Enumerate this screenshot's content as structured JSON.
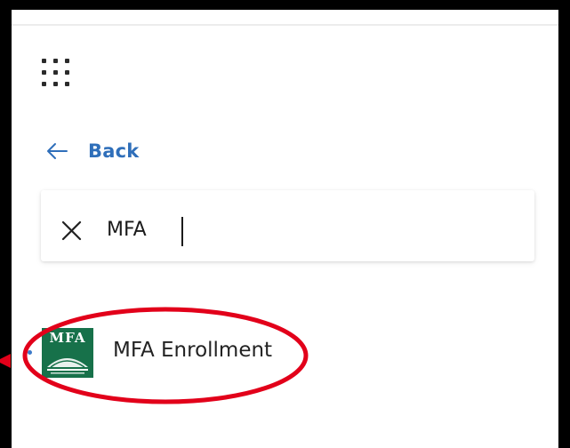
{
  "nav": {
    "back_label": "Back"
  },
  "search": {
    "value": "MFA"
  },
  "results": [
    {
      "name": "MFA Enrollment",
      "logo_text": "MFA",
      "logo_color": "#17714a"
    }
  ],
  "colors": {
    "accent": "#2f6fba",
    "annotation": "#e2001a",
    "dot": "#3c7ac9"
  },
  "icons": {
    "launcher": "waffle-grid-icon",
    "back": "arrow-left-icon",
    "clear": "close-icon"
  }
}
